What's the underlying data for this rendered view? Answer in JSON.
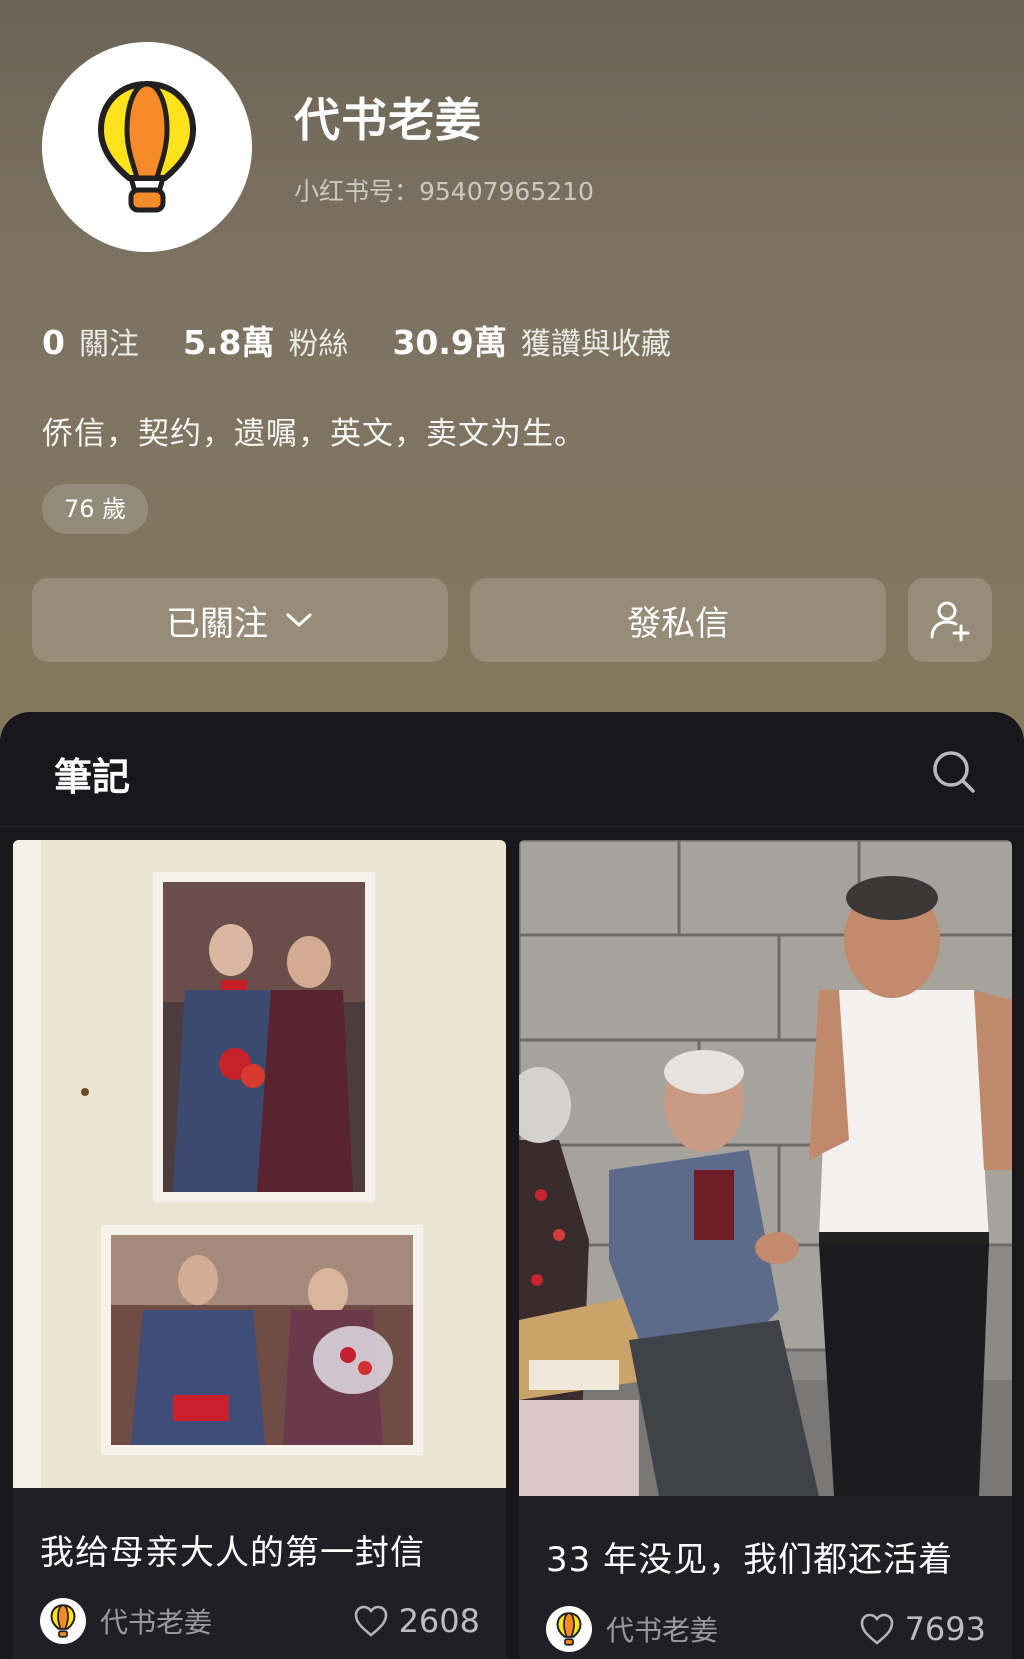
{
  "profile": {
    "name": "代书老姜",
    "id_text": "小红书号：95407965210",
    "bio": "侨信，契约，遗嘱，英文，卖文为生。",
    "age_tag": "76 歲",
    "avatar_icon": "hot-air-balloon-icon",
    "stats": [
      {
        "value": "0",
        "label": "關注"
      },
      {
        "value": "5.8萬",
        "label": "粉絲"
      },
      {
        "value": "30.9萬",
        "label": "獲讚與收藏"
      }
    ]
  },
  "actions": {
    "follow_label": "已關注",
    "message_label": "發私信",
    "add_friend_icon": "add-user-icon"
  },
  "notes": {
    "title": "筆記",
    "search_icon": "search-icon",
    "cards": [
      {
        "title": "我给母亲大人的第一封信",
        "author": "代书老姜",
        "likes": "2608"
      },
      {
        "title": "33 年没见，我们都还活着",
        "author": "代书老姜",
        "likes": "7693"
      }
    ]
  },
  "colors": {
    "header_bg": "#7c7262",
    "panel_bg": "#17171c",
    "balloon_yellow": "#fde21c",
    "balloon_orange": "#f58a2a"
  }
}
